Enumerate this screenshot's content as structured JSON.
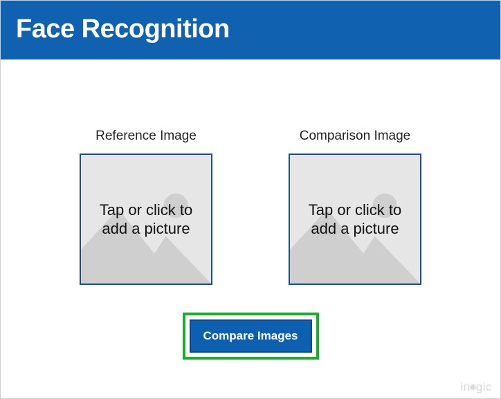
{
  "header": {
    "title": "Face Recognition"
  },
  "panels": {
    "reference": {
      "label": "Reference Image",
      "placeholder": "Tap or click to add a picture"
    },
    "comparison": {
      "label": "Comparison Image",
      "placeholder": "Tap or click to add a picture"
    }
  },
  "actions": {
    "compare_label": "Compare Images"
  },
  "watermark": {
    "text_left": "in",
    "text_right": "gic"
  }
}
